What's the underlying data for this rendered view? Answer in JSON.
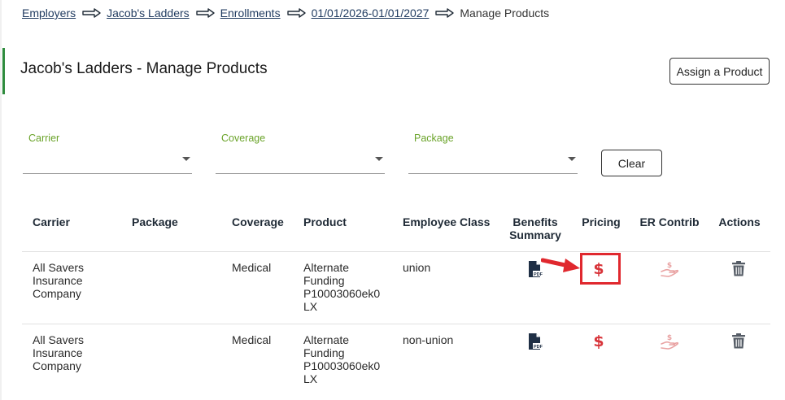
{
  "breadcrumb": {
    "items": [
      "Employers",
      "Jacob's Ladders",
      "Enrollments",
      "01/01/2026-01/01/2027"
    ],
    "current": "Manage Products"
  },
  "page": {
    "title": "Jacob's Ladders - Manage Products",
    "assign_label": "Assign a Product",
    "accent_color": "#2e8b3d"
  },
  "filters": {
    "carrier_label": "Carrier",
    "coverage_label": "Coverage",
    "package_label": "Package",
    "clear_label": "Clear",
    "label_color": "#6aa329"
  },
  "table": {
    "headers": {
      "carrier": "Carrier",
      "package": "Package",
      "coverage": "Coverage",
      "product": "Product",
      "employee_class": "Employee Class",
      "benefits_summary_1": "Benefits",
      "benefits_summary_2": "Summary",
      "pricing": "Pricing",
      "er_contrib": "ER Contrib",
      "actions": "Actions"
    },
    "rows": [
      {
        "carrier": [
          "All Savers",
          "Insurance",
          "Company"
        ],
        "package": "",
        "coverage": "Medical",
        "product": [
          "Alternate",
          "Funding",
          "P10003060ek0",
          "LX"
        ],
        "employee_class": "union"
      },
      {
        "carrier": [
          "All Savers",
          "Insurance",
          "Company"
        ],
        "package": "",
        "coverage": "Medical",
        "product": [
          "Alternate",
          "Funding",
          "P10003060ek0",
          "LX"
        ],
        "employee_class": "non-union"
      }
    ]
  },
  "icons": {
    "arrow": "right-arrow-icon",
    "pdf": "pdf-file-icon",
    "pricing": "dollar-icon",
    "contrib": "hand-dollar-icon",
    "delete": "trash-icon"
  },
  "colors": {
    "pricing_icon": "#d8343a",
    "contrib_icon": "#e9a3a3",
    "annotation": "#e0282e",
    "pdf_icon": "#1f2f45",
    "trash_icon": "#555c66"
  }
}
